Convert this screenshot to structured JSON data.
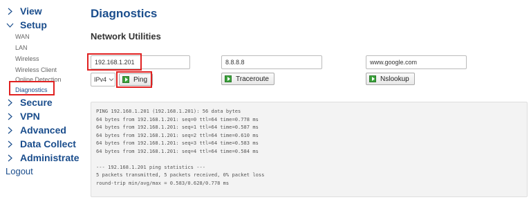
{
  "sidebar": {
    "view": "View",
    "setup": "Setup",
    "setup_items": [
      "WAN",
      "LAN",
      "Wireless",
      "Wireless Client",
      "Online Detection",
      "Diagnostics"
    ],
    "secure": "Secure",
    "vpn": "VPN",
    "advanced": "Advanced",
    "data_collect": "Data Collect",
    "administrate": "Administrate",
    "logout": "Logout",
    "active_item": "Diagnostics"
  },
  "main": {
    "title": "Diagnostics",
    "section": "Network Utilities",
    "ping_host": "192.168.1.201",
    "traceroute_host": "8.8.8.8",
    "nslookup_host": "www.google.com",
    "ip_version": "IPv4",
    "ping_label": "Ping",
    "traceroute_label": "Traceroute",
    "nslookup_label": "Nslookup",
    "output": "PING 192.168.1.201 (192.168.1.201): 56 data bytes\n64 bytes from 192.168.1.201: seq=0 ttl=64 time=0.778 ms\n64 bytes from 192.168.1.201: seq=1 ttl=64 time=0.587 ms\n64 bytes from 192.168.1.201: seq=2 ttl=64 time=0.610 ms\n64 bytes from 192.168.1.201: seq=3 ttl=64 time=0.583 ms\n64 bytes from 192.168.1.201: seq=4 ttl=64 time=0.584 ms\n\n--- 192.168.1.201 ping statistics ---\n5 packets transmitted, 5 packets received, 0% packet loss\nround-trip min/avg/max = 0.583/0.628/0.778 ms"
  },
  "colors": {
    "accent": "#1a4d8c",
    "highlight": "#e02020",
    "button_icon": "#3ba23b"
  },
  "icons": {
    "collapsed": "chevron-right-icon",
    "expanded": "chevron-down-icon",
    "button": "play-icon",
    "select": "caret-down-icon"
  }
}
